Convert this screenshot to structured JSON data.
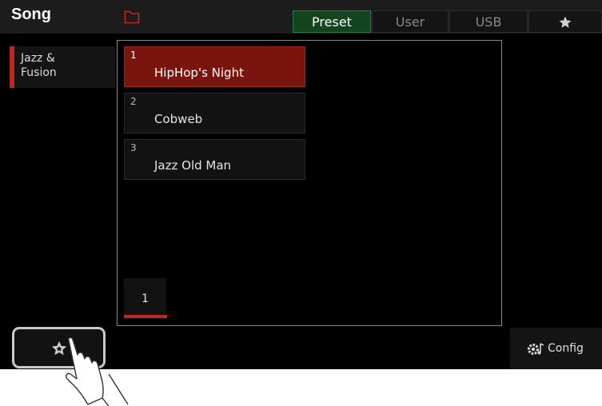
{
  "header": {
    "title": "Song",
    "folder_icon": "folder-icon",
    "tabs": [
      {
        "label": "Preset",
        "active": true
      },
      {
        "label": "User",
        "active": false
      },
      {
        "label": "USB",
        "active": false
      }
    ],
    "favorite_tab_icon": "star-icon"
  },
  "sidebar": {
    "categories": [
      {
        "label": "Jazz &\nFusion",
        "selected": true
      }
    ]
  },
  "songs": [
    {
      "number": "1",
      "name": "HipHop's Night",
      "selected": true
    },
    {
      "number": "2",
      "name": "Cobweb",
      "selected": false
    },
    {
      "number": "3",
      "name": "Jazz Old Man",
      "selected": false
    }
  ],
  "pagination": {
    "current_page": "1"
  },
  "footer": {
    "favorite_button_icon": "star-outline-icon",
    "config_label": "Config",
    "config_icon": "gear-music-icon"
  },
  "colors": {
    "selected_red": "#7a150e",
    "accent_red": "#c0281d",
    "active_tab_green": "#12451f"
  }
}
